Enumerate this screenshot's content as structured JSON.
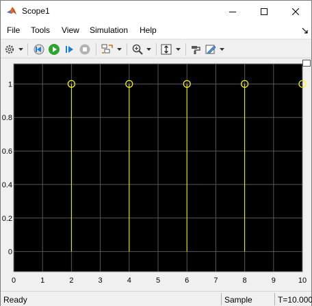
{
  "window": {
    "title": "Scope1"
  },
  "menu": {
    "items": [
      "File",
      "Tools",
      "View",
      "Simulation",
      "Help"
    ]
  },
  "toolbar": {
    "icons": [
      "gear-icon",
      "chevron-down-icon",
      "step-back-icon",
      "run-icon",
      "step-forward-icon",
      "stop-icon",
      "signal-select-icon",
      "chevron-down-icon",
      "zoom-in-icon",
      "chevron-down-icon",
      "autoscale-icon",
      "chevron-down-icon",
      "style-icon",
      "edit-icon",
      "chevron-down-icon"
    ]
  },
  "status": {
    "ready": "Ready",
    "sample_mode": "Sample based",
    "time": "T=10.000"
  },
  "colors": {
    "plot_background": "#000000",
    "figure_background": "#f0f0f0",
    "grid": "#585858",
    "signal": "#ffff00",
    "tick_label": "#000000"
  },
  "chart_data": {
    "type": "stem",
    "x": [
      2,
      4,
      6,
      8,
      10
    ],
    "y": [
      1,
      1,
      1,
      1,
      1
    ],
    "xlim": [
      0,
      10
    ],
    "ylim": [
      -0.12,
      1.12
    ],
    "xticks": [
      "0",
      "1",
      "2",
      "3",
      "4",
      "5",
      "6",
      "7",
      "8",
      "9",
      "10"
    ],
    "yticks": [
      "0",
      "0.2",
      "0.4",
      "0.6",
      "0.8",
      "1"
    ],
    "grid": true,
    "marker": "circle"
  }
}
